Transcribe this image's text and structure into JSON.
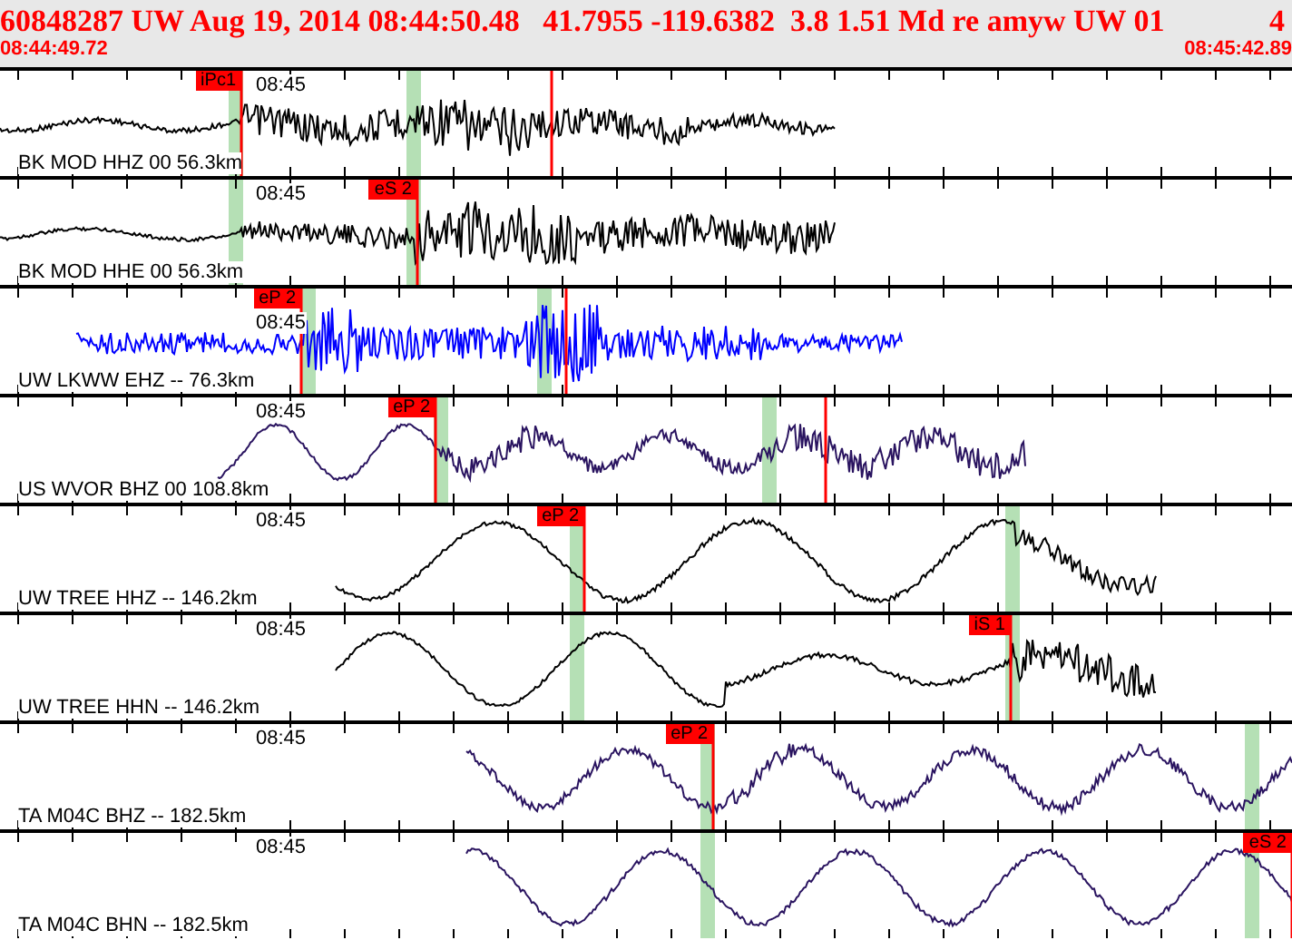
{
  "header": {
    "summary": "60848287 UW Aug 19, 2014 08:44:50.48   41.7955 -119.6382  3.8 1.51 Md re amyw UW 01",
    "trailing": "4",
    "start_time": "08:44:49.72",
    "end_time": "08:45:42.89"
  },
  "traces": [
    {
      "label": "BK MOD HHZ 00 56.3km",
      "time_label": "08:45",
      "color": "#000000",
      "picks": [
        {
          "label": "iPc1"
        }
      ]
    },
    {
      "label": "BK MOD HHE 00 56.3km",
      "time_label": "08:45",
      "color": "#000000",
      "picks": [
        {
          "label": "eS 2"
        }
      ]
    },
    {
      "label": "UW LKWW EHZ -- 76.3km",
      "time_label": "08:45",
      "color": "#0000ff",
      "picks": [
        {
          "label": "eP 2"
        }
      ]
    },
    {
      "label": "US WVOR BHZ 00 108.8km",
      "time_label": "08:45",
      "color": "#2a1460",
      "picks": [
        {
          "label": "eP 2"
        }
      ]
    },
    {
      "label": "UW TREE HHZ -- 146.2km",
      "time_label": "08:45",
      "color": "#000000",
      "picks": [
        {
          "label": "eP 2"
        }
      ]
    },
    {
      "label": "UW TREE HHN -- 146.2km",
      "time_label": "08:45",
      "color": "#000000",
      "picks": [
        {
          "label": "iS 1"
        }
      ]
    },
    {
      "label": "TA M04C BHZ -- 182.5km",
      "time_label": "08:45",
      "color": "#2a1460",
      "picks": [
        {
          "label": "eP 2"
        }
      ]
    },
    {
      "label": "TA M04C BHN -- 182.5km",
      "time_label": "08:45",
      "color": "#2a1460",
      "picks": [
        {
          "label": "eS 2"
        }
      ]
    }
  ]
}
